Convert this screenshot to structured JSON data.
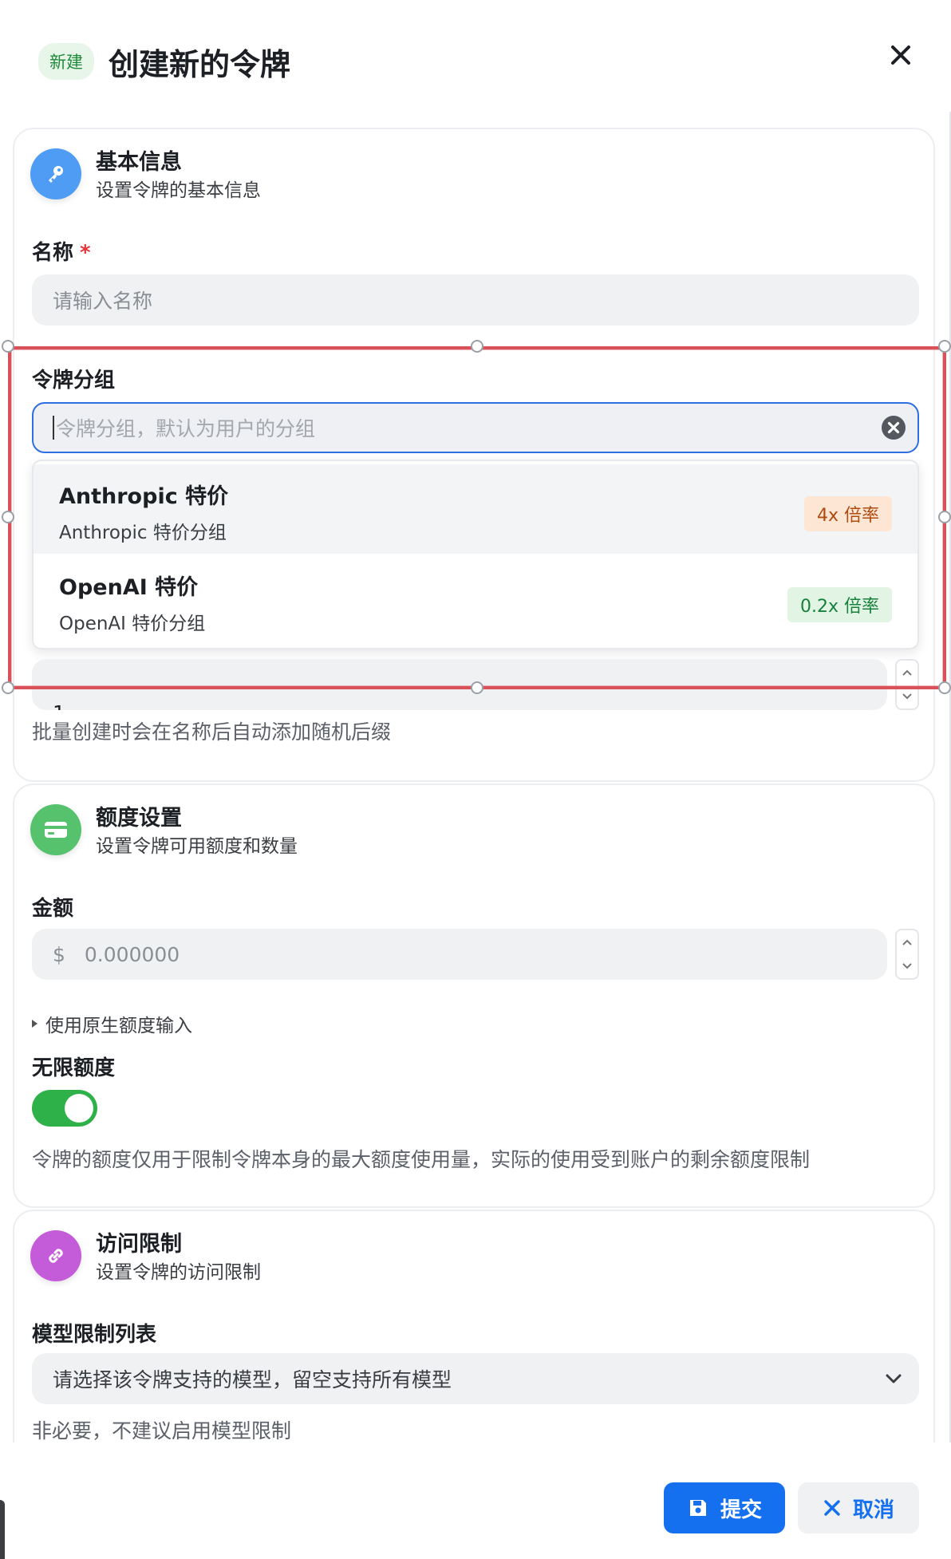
{
  "header": {
    "badge": "新建",
    "title": "创建新的令牌"
  },
  "basic": {
    "title": "基本信息",
    "subtitle": "设置令牌的基本信息",
    "name_label": "名称",
    "required_mark": "*",
    "name_placeholder": "请输入名称",
    "group_label": "令牌分组",
    "group_placeholder": "令牌分组，默认为用户的分组",
    "group_options": [
      {
        "title": "Anthropic 特价",
        "desc": "Anthropic 特价分组",
        "rate": "4x 倍率",
        "rate_color": "#b04a0e"
      },
      {
        "title": "OpenAI 特价",
        "desc": "OpenAI 特价分组",
        "rate": "0.2x 倍率",
        "rate_color": "#17803a"
      }
    ],
    "count_value": "1",
    "count_helper": "批量创建时会在名称后自动添加随机后缀"
  },
  "quota": {
    "title": "额度设置",
    "subtitle": "设置令牌可用额度和数量",
    "amount_label": "金额",
    "currency": "$",
    "amount_placeholder": "0.000000",
    "native_toggle": "使用原生额度输入",
    "unlimited_label": "无限额度",
    "unlimited_on": true,
    "unlimited_helper": "令牌的额度仅用于限制令牌本身的最大额度使用量，实际的使用受到账户的剩余额度限制"
  },
  "access": {
    "title": "访问限制",
    "subtitle": "设置令牌的访问限制",
    "model_label": "模型限制列表",
    "model_placeholder": "请选择该令牌支持的模型，留空支持所有模型",
    "model_helper": "非必要，不建议启用模型限制"
  },
  "footer": {
    "submit": "提交",
    "cancel": "取消"
  },
  "colors": {
    "primary": "#1570ef",
    "switch_on": "#2fb14a",
    "selection": "#d9525a"
  },
  "icons": {
    "basic": "key-icon",
    "quota": "credit-card-icon",
    "access": "link-icon",
    "close": "close-icon"
  }
}
